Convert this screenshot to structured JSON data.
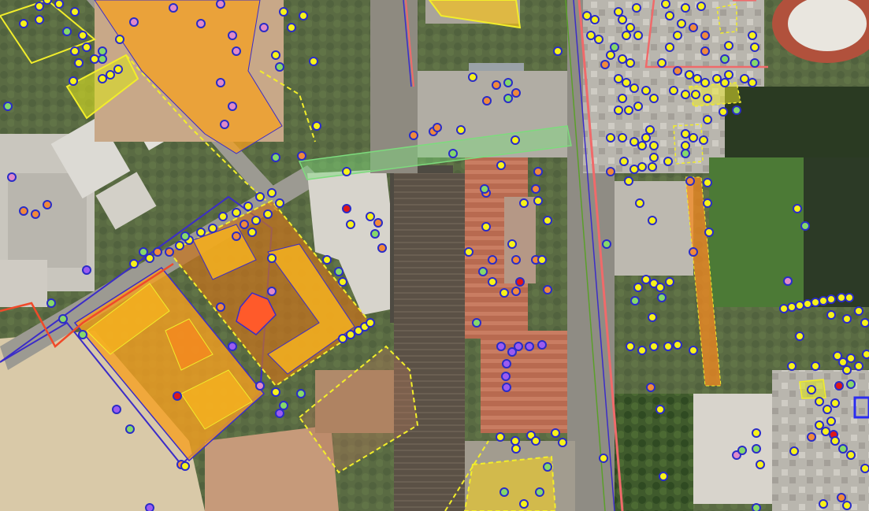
{
  "map": {
    "type": "aerial-gis-overlay",
    "colors": {
      "poi_border": "#2a2cc8",
      "poi_yellow": "#f7f21a",
      "poi_orange": "#f08a3c",
      "poi_green": "#86d86a",
      "poi_violet": "#9b5cf0",
      "poi_pink": "#e08ac8",
      "poi_red": "#e01818",
      "zone_orange": "#f5a020",
      "zone_red": "#ff5a2a",
      "boundary_yellow": "#f2ee2a",
      "boundary_blue": "#3b2cc8",
      "road_red": "#f06a6a",
      "greenway": "#7ddb7d"
    }
  }
}
